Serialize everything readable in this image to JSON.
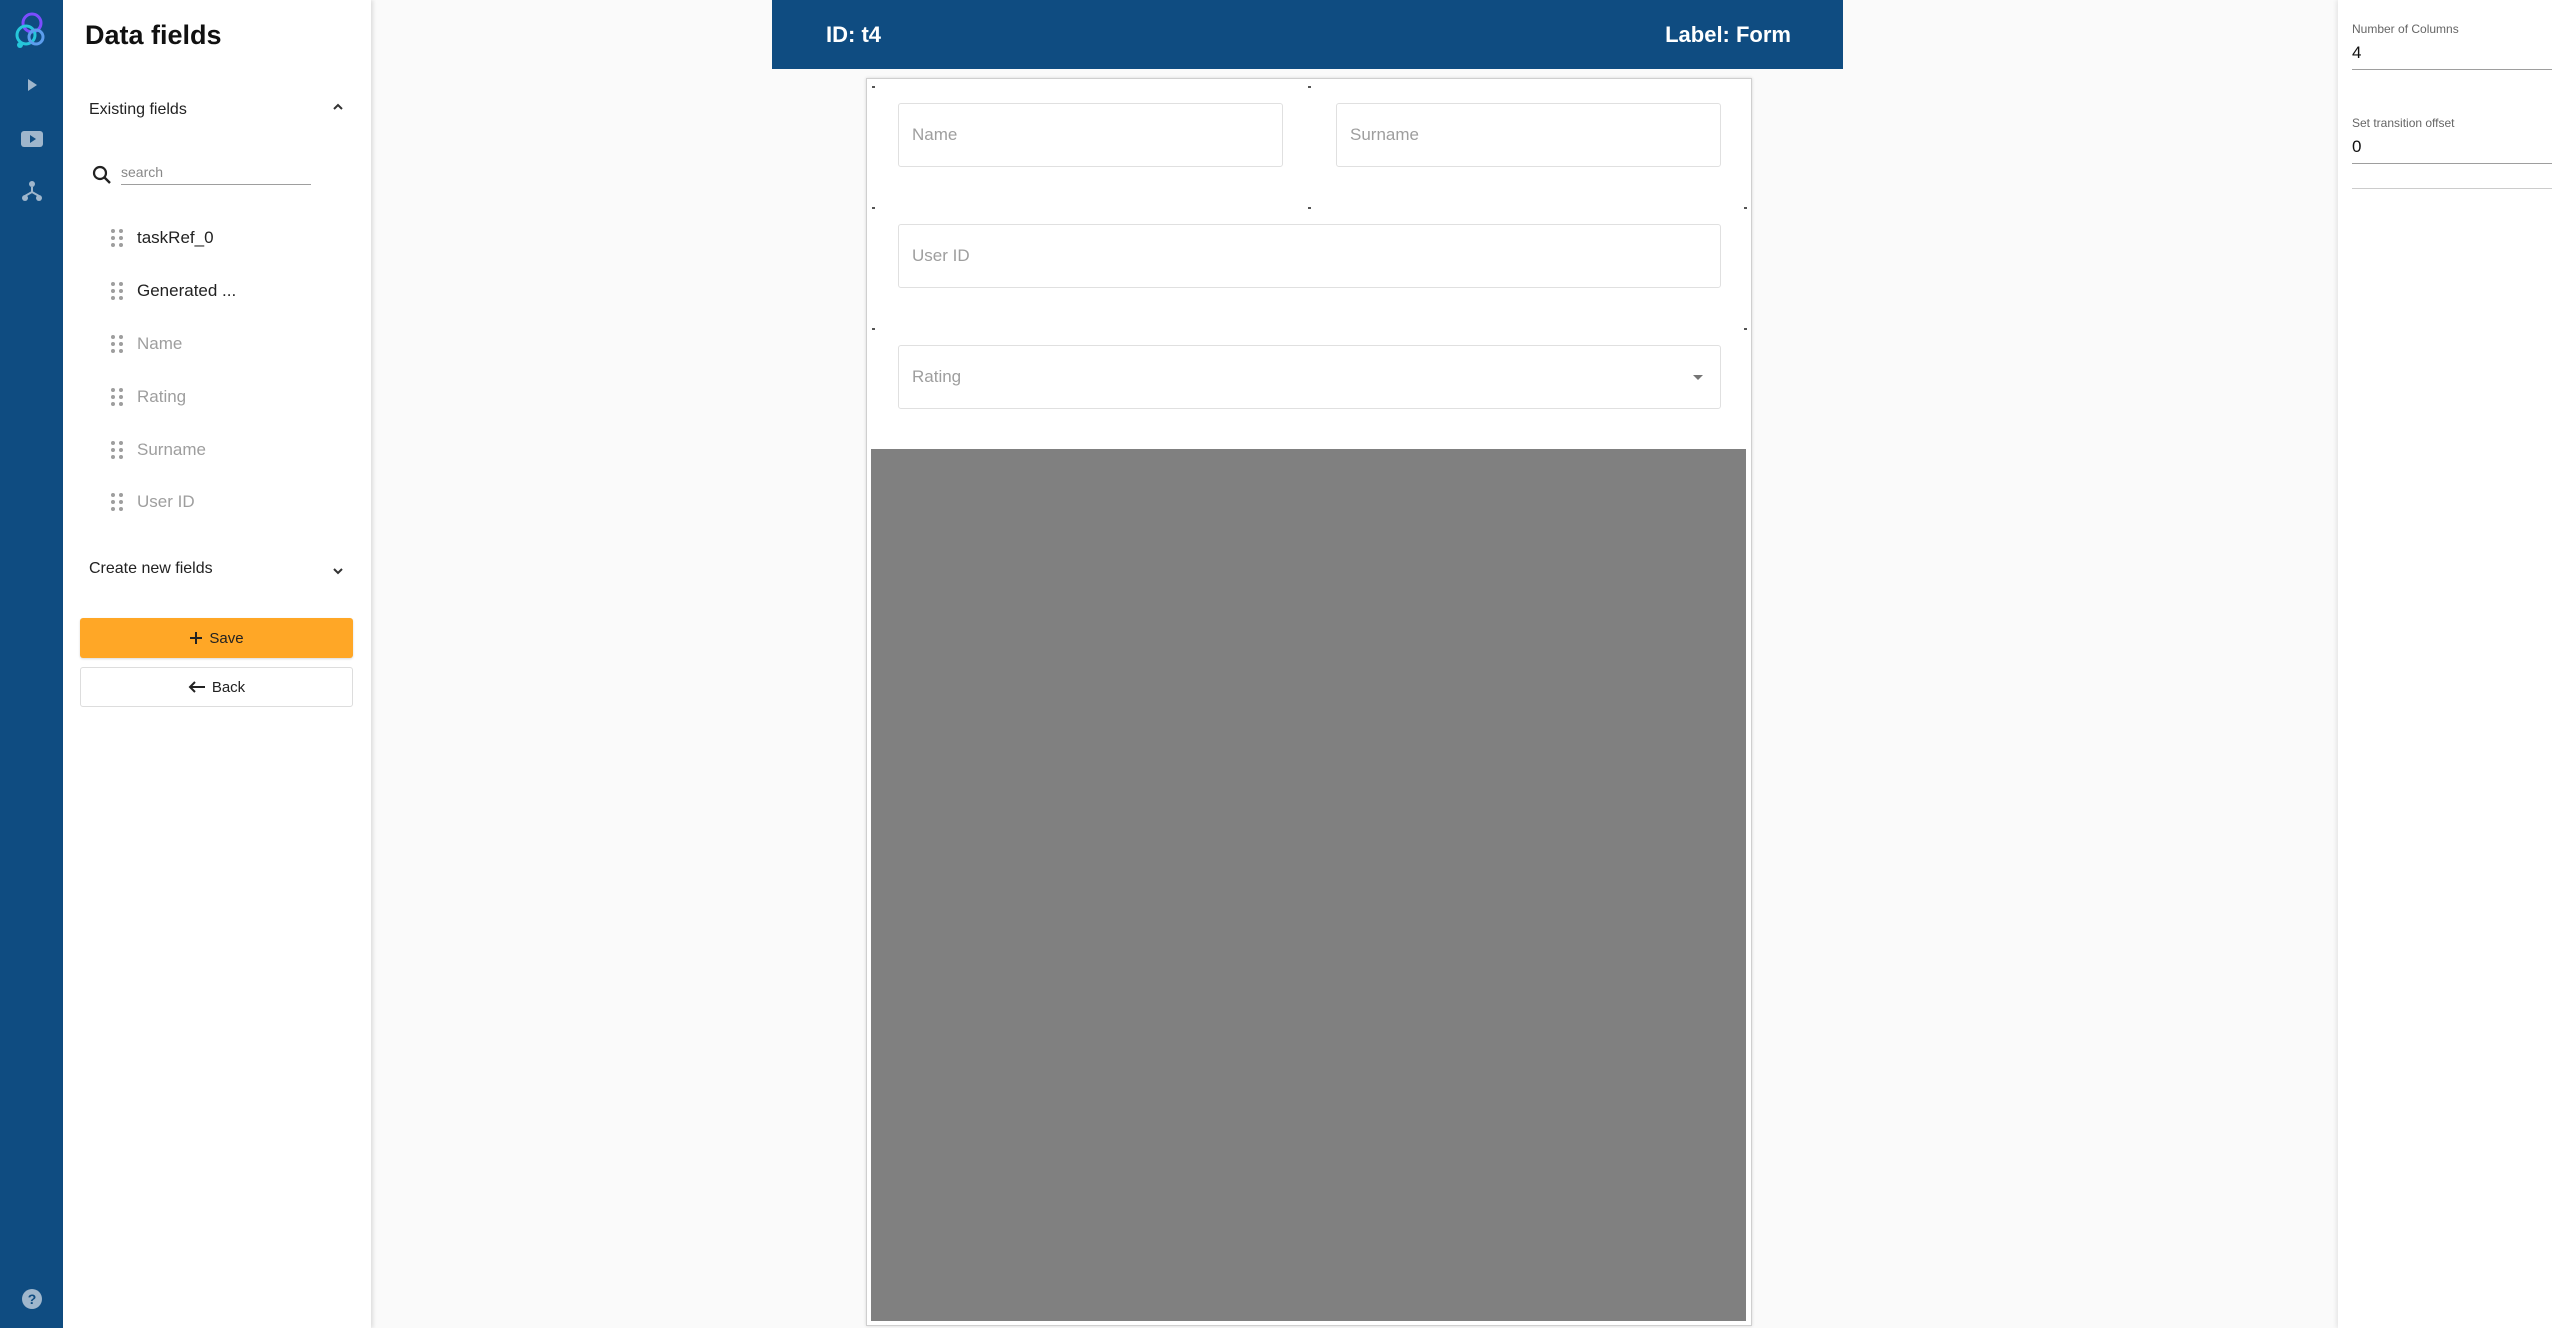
{
  "rail": {
    "icons": [
      "logo-icon",
      "play-icon",
      "video-icon",
      "network-icon",
      "help-icon"
    ]
  },
  "panel": {
    "title": "Data fields",
    "existing_section": "Existing fields",
    "search_placeholder": "search",
    "existing_fields": [
      {
        "label": "taskRef_0",
        "state": "active"
      },
      {
        "label": "Generated ...",
        "state": "active"
      },
      {
        "label": "Name",
        "state": "inactive"
      },
      {
        "label": "Rating",
        "state": "inactive"
      },
      {
        "label": "Surname",
        "state": "inactive"
      },
      {
        "label": "User ID",
        "state": "inactive"
      }
    ],
    "create_section": "Create new fields",
    "save_label": "Save",
    "back_label": "Back"
  },
  "header": {
    "id_text": "ID: t4",
    "label_text": "Label: Form"
  },
  "form": {
    "fields": {
      "name": "Name",
      "surname": "Surname",
      "user_id": "User ID",
      "rating": "Rating"
    }
  },
  "props": {
    "columns_label": "Number of Columns",
    "columns_value": "4",
    "offset_label": "Set transition offset",
    "offset_value": "0"
  },
  "colors": {
    "primary": "#0f4c81",
    "accent": "#ffa726",
    "canvas_gray": "#808080"
  }
}
